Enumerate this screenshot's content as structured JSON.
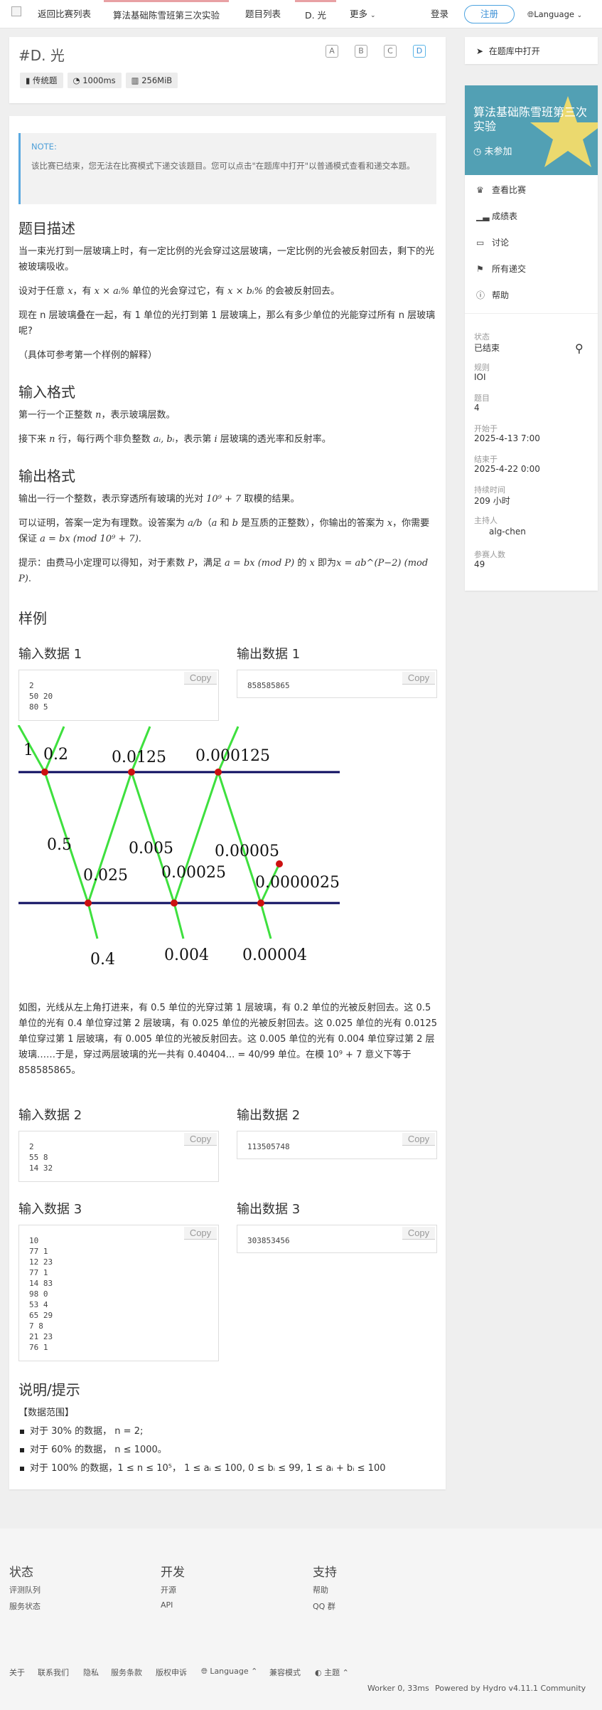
{
  "nav": {
    "items": [
      "返回比赛列表",
      "算法基础陈雪班第三次实验",
      "题目列表",
      "D. 光",
      "更多"
    ],
    "login": "登录",
    "register": "注册",
    "language": "Language"
  },
  "problem": {
    "title": "#D. 光",
    "letters": [
      "A",
      "B",
      "C",
      "D"
    ],
    "type": "传统题",
    "time": "1000ms",
    "memory": "256MiB"
  },
  "note": {
    "label": "NOTE:",
    "text": "该比赛已结束，您无法在比赛模式下递交该题目。您可以点击\"在题库中打开\"以普通模式查看和递交本题。"
  },
  "content": {
    "h_desc": "题目描述",
    "desc1": "当一束光打到一层玻璃上时，有一定比例的光会穿过这层玻璃，一定比例的光会被反射回去，剩下的光被玻璃吸收。",
    "desc2a": "设对于任意 ",
    "desc2b": "x",
    "desc2c": "，有 ",
    "desc2d": "x × aᵢ%",
    "desc2e": " 单位的光会穿过它，有 ",
    "desc2f": "x × bᵢ%",
    "desc2g": " 的会被反射回去。",
    "desc3": "现在 n 层玻璃叠在一起，有 1 单位的光打到第 1 层玻璃上，那么有多少单位的光能穿过所有 n 层玻璃呢?",
    "desc4": "（具体可参考第一个样例的解释）",
    "h_input": "输入格式",
    "in1a": "第一行一个正整数 ",
    "in1b": "n",
    "in1c": "，表示玻璃层数。",
    "in2a": "接下来 ",
    "in2b": "n",
    "in2c": " 行，每行两个非负整数 ",
    "in2d": "aᵢ, bᵢ",
    "in2e": "，表示第 ",
    "in2f": "i",
    "in2g": " 层玻璃的透光率和反射率。",
    "h_output": "输出格式",
    "out1a": "输出一行一个整数，表示穿透所有玻璃的光对 ",
    "out1b": "10⁹ + 7",
    "out1c": " 取模的结果。",
    "out2a": "可以证明，答案一定为有理数。设答案为 ",
    "out2b": "a/b",
    "out2c": "（",
    "out2d": "a",
    "out2e": " 和 ",
    "out2f": "b",
    "out2g": " 是互质的正整数），你输出的答案为 ",
    "out2h": "x",
    "out2i": "，你需要保证 ",
    "out2j": "a = bx (mod 10⁹ + 7)",
    "out2k": ".",
    "out3a": "提示：由费马小定理可以得知，对于素数 ",
    "out3b": "P",
    "out3c": "，满足 ",
    "out3d": "a = bx (mod P)",
    "out3e": " 的 ",
    "out3f": "x",
    "out3g": " 即为",
    "out3h": "x = ab^(P−2) (mod P)",
    "out3i": ".",
    "h_samples": "样例",
    "in_label1": "输入数据 1",
    "out_label1": "输出数据 1",
    "in_data1": "2\n50 20\n80 5",
    "out_data1": "858585865",
    "in_label2": "输入数据 2",
    "out_label2": "输出数据 2",
    "in_data2": "2\n55 8\n14 32",
    "out_data2": "113505748",
    "in_label3": "输入数据 3",
    "out_label3": "输出数据 3",
    "in_data3": "10\n77 1\n12 23\n77 1\n14 83\n98 0\n53 4\n65 29\n7 8\n21 23\n76 1",
    "out_data3": "303853456",
    "copy": "Copy",
    "explain": "如图，光线从左上角打进来，有 0.5 单位的光穿过第 1 层玻璃，有 0.2 单位的光被反射回去。这 0.5 单位的光有 0.4 单位穿过第 2 层玻璃，有 0.025 单位的光被反射回去。这 0.025 单位的光有 0.0125 单位穿过第 1 层玻璃，有 0.005 单位的光被反射回去。这 0.005 单位的光有 0.004 单位穿过第 2 层玻璃……于是，穿过两层玻璃的光一共有 0.40404... = 40/99 单位。在模 10⁹ + 7 意义下等于 858585865。",
    "h_hint": "说明/提示",
    "range_title": "【数据范围】",
    "range1": "对于 30% 的数据， n = 2;",
    "range2": "对于 60% 的数据， n ≤ 1000。",
    "range3": "对于 100% 的数据，1 ≤ n ≤ 10⁵， 1 ≤ aᵢ ≤ 100, 0 ≤ bᵢ ≤ 99, 1 ≤ aᵢ + bᵢ ≤ 100"
  },
  "figure": {
    "labels": [
      "1",
      "0.2",
      "0.0125",
      "0.000125",
      "0.5",
      "0.005",
      "0.00005",
      "0.025",
      "0.00025",
      "0.0000025",
      "0.4",
      "0.004",
      "0.00004"
    ]
  },
  "sidebar": {
    "open_in_repo": "在题库中打开",
    "contest_title": "算法基础陈雪班第三次实验",
    "contest_status": "未参加",
    "menu": [
      "查看比赛",
      "成绩表",
      "讨论",
      "所有递交",
      "帮助"
    ],
    "info": [
      {
        "label": "状态",
        "value": "已结束"
      },
      {
        "label": "规则",
        "value": "IOI"
      },
      {
        "label": "题目",
        "value": "4"
      },
      {
        "label": "开始于",
        "value": "2025-4-13 7:00"
      },
      {
        "label": "结束于",
        "value": "2025-4-22 0:00"
      },
      {
        "label": "持续时间",
        "value": "209 小时"
      },
      {
        "label": "主持人",
        "value": "alg-chen"
      },
      {
        "label": "参赛人数",
        "value": "49"
      }
    ]
  },
  "footer": {
    "col1_h": "状态",
    "col1": [
      "评测队列",
      "服务状态"
    ],
    "col2_h": "开发",
    "col2": [
      "开源",
      "API"
    ],
    "col3_h": "支持",
    "col3": [
      "帮助",
      "QQ 群"
    ],
    "bottom": [
      "关于",
      "联系我们",
      "隐私",
      "服务条款",
      "版权申诉",
      "Language",
      "兼容模式",
      "主题"
    ],
    "worker": "Worker 0, 33ms",
    "powered": "Powered by Hydro v4.11.1 Community"
  },
  "colors": {
    "accent": "#4ca3e0",
    "banner": "#52a0b4",
    "ray": "#3ee03e",
    "glass": "#0a0a5e"
  }
}
